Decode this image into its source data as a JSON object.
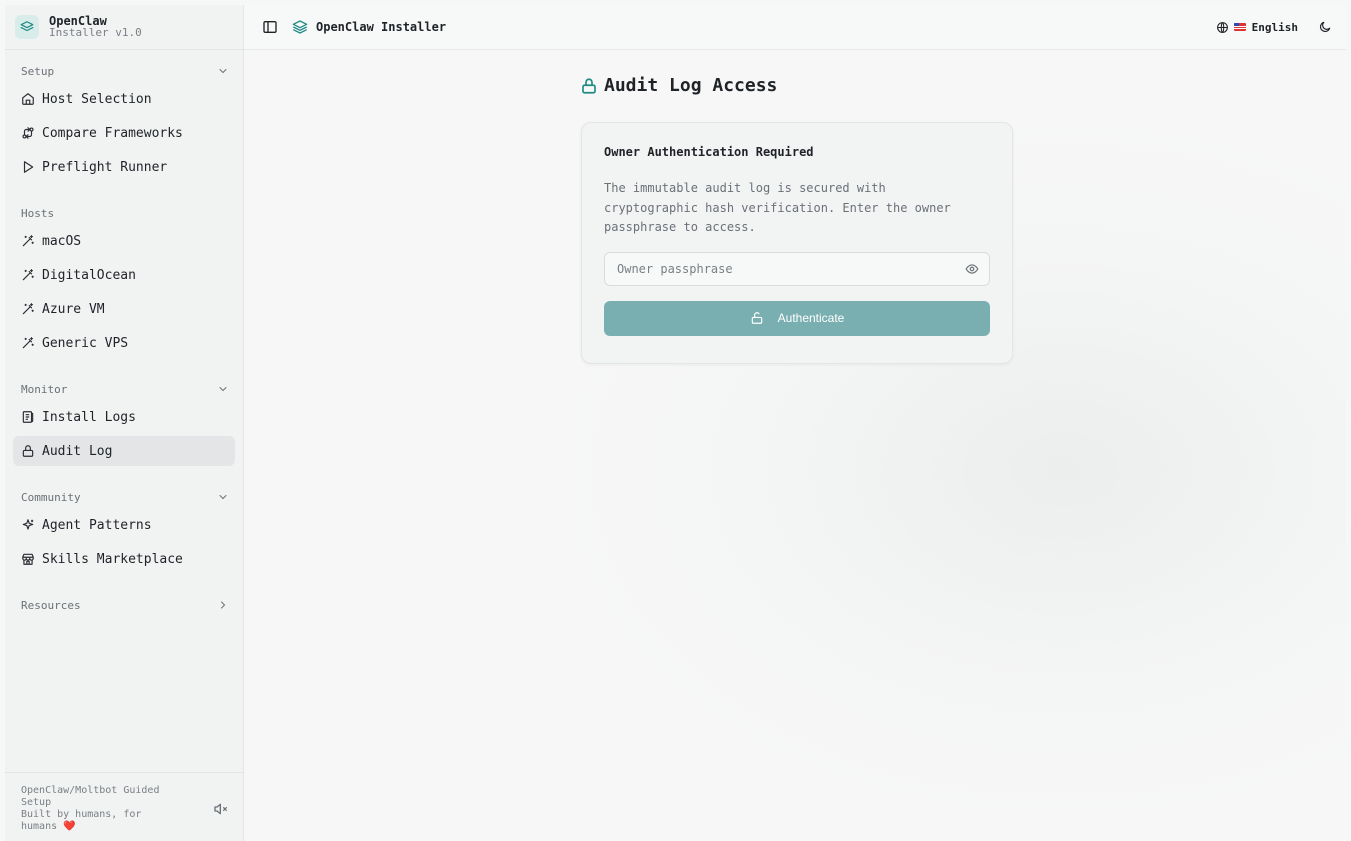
{
  "brand": {
    "name": "OpenClaw",
    "version": "Installer v1.0"
  },
  "sidebar": {
    "groups": [
      {
        "label": "Setup",
        "chevron": "down",
        "items": [
          {
            "label": "Host Selection",
            "icon": "home-icon"
          },
          {
            "label": "Compare Frameworks",
            "icon": "compare-icon"
          },
          {
            "label": "Preflight Runner",
            "icon": "play-icon"
          }
        ]
      },
      {
        "label": "Hosts",
        "items": [
          {
            "label": "macOS",
            "icon": "wand-icon"
          },
          {
            "label": "DigitalOcean",
            "icon": "wand-icon"
          },
          {
            "label": "Azure VM",
            "icon": "wand-icon"
          },
          {
            "label": "Generic VPS",
            "icon": "wand-icon"
          }
        ]
      },
      {
        "label": "Monitor",
        "chevron": "down",
        "items": [
          {
            "label": "Install Logs",
            "icon": "scroll-icon"
          },
          {
            "label": "Audit Log",
            "icon": "lock-icon",
            "active": true
          }
        ]
      },
      {
        "label": "Community",
        "chevron": "down",
        "items": [
          {
            "label": "Agent Patterns",
            "icon": "sparkles-icon"
          },
          {
            "label": "Skills Marketplace",
            "icon": "store-icon"
          }
        ]
      },
      {
        "label": "Resources",
        "chevron": "right",
        "items": []
      }
    ],
    "footer": {
      "line1": "OpenClaw/Moltbot Guided Setup",
      "line2": "Built by humans, for humans",
      "heart": "❤️",
      "mute_icon": "speaker-muted-icon"
    }
  },
  "topbar": {
    "title": "OpenClaw Installer",
    "language": "English"
  },
  "main": {
    "title": "Audit Log Access",
    "card": {
      "title": "Owner Authentication Required",
      "description": "The immutable audit log is secured with cryptographic hash verification. Enter the owner passphrase to access.",
      "passphrase_placeholder": "Owner passphrase",
      "passphrase_value": "",
      "button_label": "Authenticate"
    }
  },
  "colors": {
    "accent": "#1f8a84",
    "button_bg": "#7aafb2",
    "active_item_bg": "#e3e5e6"
  }
}
